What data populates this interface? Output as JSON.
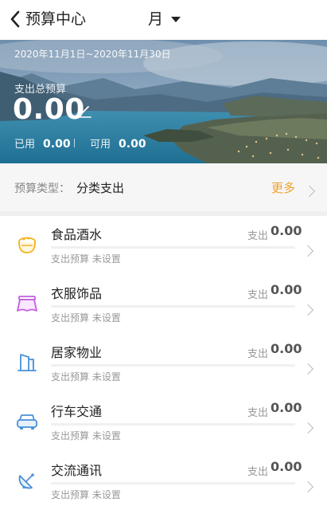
{
  "header": {
    "title": "预算中心",
    "period": "月"
  },
  "banner": {
    "date_range": "2020年11月1日~2020年11月30日",
    "total_label": "支出总预算",
    "total_value": "0.00",
    "used_label": "已用",
    "used_value": "0.00",
    "available_label": "可用",
    "available_value": "0.00"
  },
  "budget_type": {
    "label": "预算类型：",
    "value": "分类支出",
    "more": "更多"
  },
  "categories": [
    {
      "name": "食品酒水",
      "spend_label": "支出",
      "spend_value": "0.00",
      "budget_status": "支出预算 未设置",
      "icon": "food-bowl-icon",
      "color": "#f1b21d"
    },
    {
      "name": "衣服饰品",
      "spend_label": "支出",
      "spend_value": "0.00",
      "budget_status": "支出预算 未设置",
      "icon": "clothing-icon",
      "color": "#c45ee0"
    },
    {
      "name": "居家物业",
      "spend_label": "支出",
      "spend_value": "0.00",
      "budget_status": "支出预算 未设置",
      "icon": "building-icon",
      "color": "#4a90d9"
    },
    {
      "name": "行车交通",
      "spend_label": "支出",
      "spend_value": "0.00",
      "budget_status": "支出预算 未设置",
      "icon": "car-icon",
      "color": "#4a90d9"
    },
    {
      "name": "交流通讯",
      "spend_label": "支出",
      "spend_value": "0.00",
      "budget_status": "支出预算 未设置",
      "icon": "satellite-dish-icon",
      "color": "#4a90d9"
    }
  ],
  "colors": {
    "accent": "#f0a12b",
    "text": "#222222",
    "muted": "#999999"
  }
}
